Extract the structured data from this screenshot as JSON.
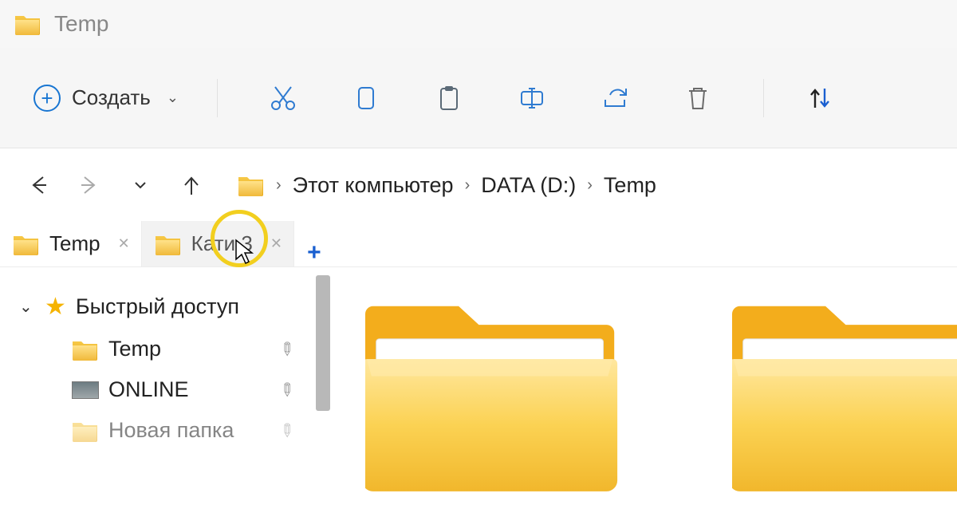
{
  "window": {
    "title": "Temp"
  },
  "toolbar": {
    "create_label": "Создать"
  },
  "breadcrumb": {
    "items": [
      "Этот компьютер",
      "DATA (D:)",
      "Temp"
    ]
  },
  "tabs": [
    {
      "label": "Temp",
      "active": true
    },
    {
      "label": "Кати 3",
      "active": false
    }
  ],
  "sidebar": {
    "quick_access_label": "Быстрый доступ",
    "items": [
      {
        "label": "Temp",
        "icon": "folder",
        "pinned": true
      },
      {
        "label": "ONLINE",
        "icon": "image",
        "pinned": true
      },
      {
        "label": "Новая папка",
        "icon": "folder",
        "pinned": true
      }
    ]
  }
}
